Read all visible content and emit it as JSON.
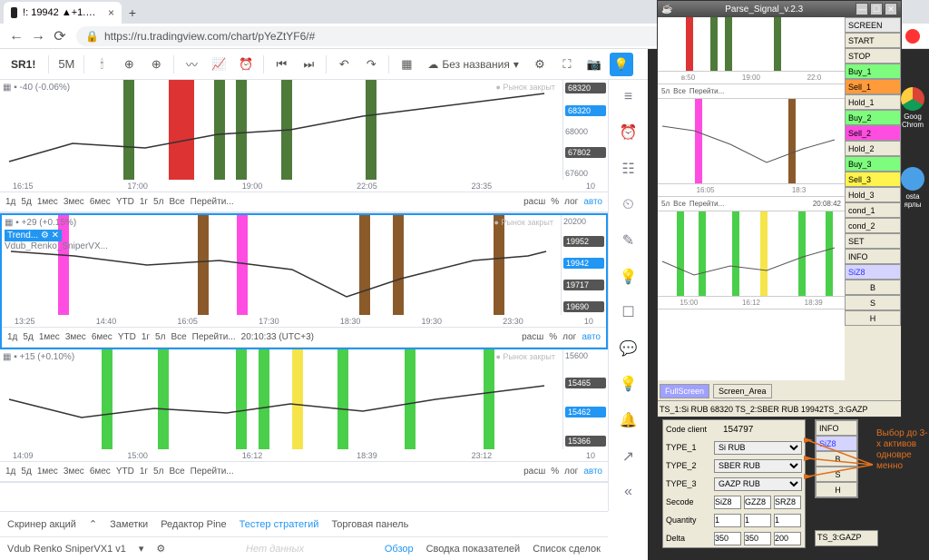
{
  "browser": {
    "tab_title": "!: 19942 ▲+1.14% — Без наз",
    "url": "https://ru.tradingview.com/chart/pYeZtYF6/#"
  },
  "toolbar": {
    "symbol": "SR1!",
    "interval": "5М",
    "unnamed": "Без названия"
  },
  "side_icons": [
    "≡",
    "⏰",
    "☷",
    "⏲",
    "✎",
    "💡",
    "☐",
    "💬",
    "💡",
    "🔔",
    "↗",
    "«"
  ],
  "time_ranges": [
    "1д",
    "5д",
    "1мес",
    "3мес",
    "6мес",
    "YTD",
    "1г",
    "5л",
    "Все",
    "Перейти..."
  ],
  "right_opts": [
    "расш",
    "%",
    "лог",
    "авто"
  ],
  "chart1": {
    "legend": "▦ ▪ -40 (-0.06%)",
    "status": "● Рынок закрыт",
    "scale": [
      "67000.0000",
      "66600.0000",
      "66200.0000"
    ],
    "tags": [
      "68320",
      "68320",
      "68000",
      "67802",
      "67600"
    ],
    "x": [
      "16:15",
      "17:00",
      "19:00",
      "22:05",
      "23:35",
      "10"
    ]
  },
  "chart2": {
    "legend": "▦ ▪ +29 (+0.15%)",
    "legend2": "Vdub_Renko_SniperVX...",
    "status": "● Рынок закрыт",
    "scale": [
      "20400.0000",
      "20200.0000",
      "20000.0000",
      "19800.0000"
    ],
    "tags": [
      "20200",
      "19952",
      "19942",
      "19717",
      "19690"
    ],
    "x": [
      "13:25",
      "14:40",
      "16:05",
      "17:30",
      "18:30",
      "19:30",
      "23:30",
      "10"
    ],
    "clock": "20:10:33 (UTC+3)"
  },
  "chart3": {
    "legend": "▦ ▪ +15 (+0.10%)",
    "status": "● Рынок закрыт",
    "scale": [
      "15420.0000",
      "15400.0000",
      "15380.0000"
    ],
    "tags": [
      "15600",
      "15465",
      "15462",
      "15366"
    ],
    "x": [
      "14:09",
      "15:00",
      "16:12",
      "18:39",
      "23:12",
      "10"
    ]
  },
  "bottom_tabs": [
    "Скринер акций",
    "Заметки",
    "Редактор Pine",
    "Тестер стратегий",
    "Торговая панель"
  ],
  "strategy": {
    "name": "Vdub Renko SniperVX1 v1",
    "tabs": [
      "Обзор",
      "Сводка показателей",
      "Список сделок"
    ],
    "nodata": "Нет данных"
  },
  "ps": {
    "title": "Parse_Signal_v.2.3",
    "controls": [
      "SCREEN",
      "START",
      "STOP",
      "Buy_1",
      "Sell_1",
      "Hold_1",
      "Buy_2",
      "Sell_2",
      "Hold_2",
      "Buy_3",
      "Sell_3",
      "Hold_3",
      "cond_1",
      "cond_2",
      "SET",
      "INFO",
      "SiZ8"
    ],
    "mini": [
      "B",
      "S",
      "H"
    ],
    "status": "TS_1:Si RUB 68320 TS_2:SBER RUB 19942TS_3:GAZP",
    "footer": [
      "FullScreen",
      "Screen_Area"
    ],
    "chart1_x": [
      "в:50",
      "19:00",
      "22:0"
    ],
    "bar1": [
      "5л",
      "Все",
      "Перейти..."
    ],
    "chart2_x": [
      "16:05",
      "18:3"
    ],
    "bar2": [
      "5л",
      "Все",
      "Перейти...",
      "20:08:42"
    ],
    "chart3_x": [
      "15:00",
      "16:12",
      "18:39"
    ]
  },
  "bp": {
    "code_label": "Code client",
    "code_val": "154797",
    "t1": "TYPE_1",
    "v1": "Si RUB",
    "t2": "TYPE_2",
    "v2": "SBER RUB",
    "t3": "TYPE_3",
    "v3": "GAZP RUB",
    "sec": "Secode",
    "sec1": "SiZ8",
    "sec2": "GZZ8",
    "sec3": "SRZ8",
    "qty": "Quantity",
    "q1": "1",
    "q2": "1",
    "q3": "1",
    "delta": "Delta",
    "d1": "350",
    "d2": "350",
    "d3": "200",
    "info": "INFO",
    "siz": "SiZ8",
    "b": "B",
    "s": "S",
    "h": "H",
    "ts": "TS_3:GAZP",
    "note": "Выбор\nдо\n3-х\nактивов\nодновре\nменно"
  },
  "desk": {
    "chrome": "Goog\nChrom",
    "other": "osta\nярлы"
  },
  "chart_data": [
    {
      "type": "bar",
      "panel": 1,
      "bars": [
        {
          "x": "16:30",
          "c": "#4e7a3a"
        },
        {
          "x": "16:50",
          "c": "#d33"
        },
        {
          "x": "17:20",
          "c": "#4e7a3a"
        },
        {
          "x": "17:35",
          "c": "#4e7a3a"
        },
        {
          "x": "19:00",
          "c": "#4e7a3a"
        },
        {
          "x": "22:00",
          "c": "#4e7a3a"
        }
      ]
    },
    {
      "type": "bar",
      "panel": 2,
      "bars": [
        {
          "x": "13:25",
          "c": "#ff4de1"
        },
        {
          "x": "15:40",
          "c": "#8b5a2b"
        },
        {
          "x": "16:20",
          "c": "#ff4de1"
        },
        {
          "x": "18:30",
          "c": "#8b5a2b"
        },
        {
          "x": "19:00",
          "c": "#8b5a2b"
        },
        {
          "x": "23:00",
          "c": "#8b5a2b"
        }
      ]
    },
    {
      "type": "bar",
      "panel": 3,
      "bars": [
        {
          "x": "14:20",
          "c": "#4acf4a"
        },
        {
          "x": "14:50",
          "c": "#4acf4a"
        },
        {
          "x": "15:20",
          "c": "#4acf4a"
        },
        {
          "x": "15:35",
          "c": "#4acf4a"
        },
        {
          "x": "16:12",
          "c": "#f5e54a"
        },
        {
          "x": "17:30",
          "c": "#4acf4a"
        },
        {
          "x": "18:39",
          "c": "#4acf4a"
        },
        {
          "x": "23:00",
          "c": "#4acf4a"
        }
      ]
    }
  ]
}
